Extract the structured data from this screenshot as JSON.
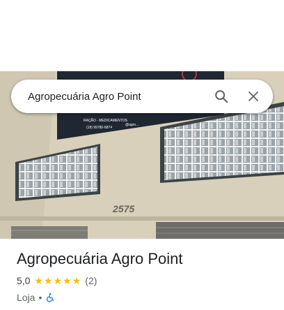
{
  "search": {
    "query": "Agropecuária Agro Point"
  },
  "icons": {
    "search": "search-icon",
    "close": "close-icon",
    "accessibility": "wheelchair-icon"
  },
  "photo": {
    "banner_lines": [
      "RAÇÃO · MEDICAMENTOS",
      "(18) 99780-6874",
      "@agro..."
    ],
    "address_number": "2575"
  },
  "place": {
    "name": "Agropecuária Agro Point",
    "rating": "5,0",
    "stars": 5,
    "reviews": "(2)",
    "category": "Loja",
    "separator": "•"
  },
  "colors": {
    "star": "#fbbc04",
    "accessibility": "#1a73e8",
    "text": "#202124",
    "secondary": "#5f6368"
  }
}
